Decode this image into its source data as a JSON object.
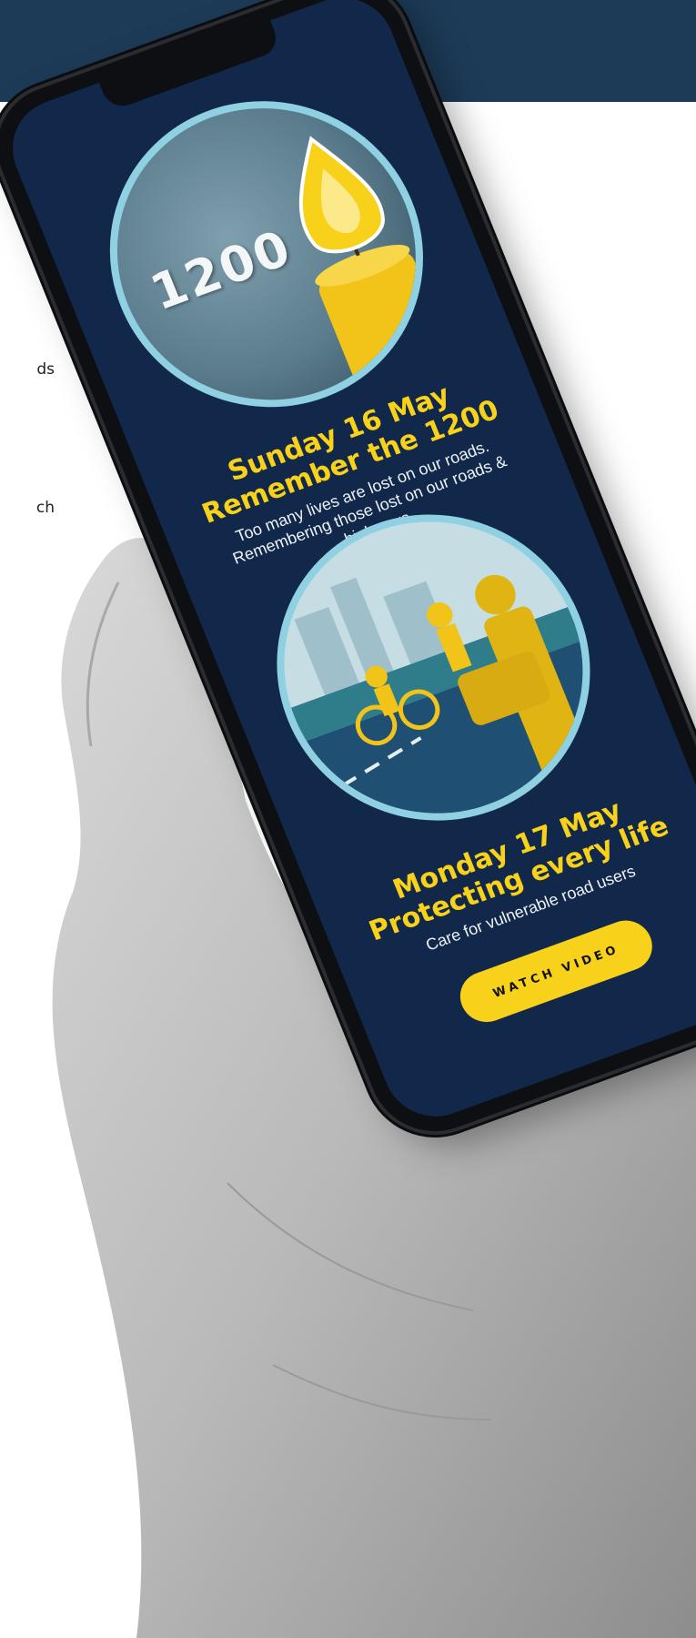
{
  "background": {
    "band_color": "#1d3a57"
  },
  "left_text": {
    "fragment_1": "ds",
    "fragment_2": "ch"
  },
  "phone": {
    "screen_color": "#12284a",
    "accent_yellow": "#f8d21a",
    "ring_color": "#8fd1e3",
    "event_1": {
      "badge_number": "1200",
      "date": "Sunday 16 May",
      "headline": "Remember the 1200",
      "description": "Too many lives are lost on our roads. Remembering those lost on our roads & highways",
      "icon": "candle-icon"
    },
    "event_2": {
      "date": "Monday 17 May",
      "headline": "Protecting every life",
      "description": "Care for vulnerable road users",
      "icon": "road-users-illustration"
    },
    "watch_button_label": "WATCH VIDEO"
  }
}
